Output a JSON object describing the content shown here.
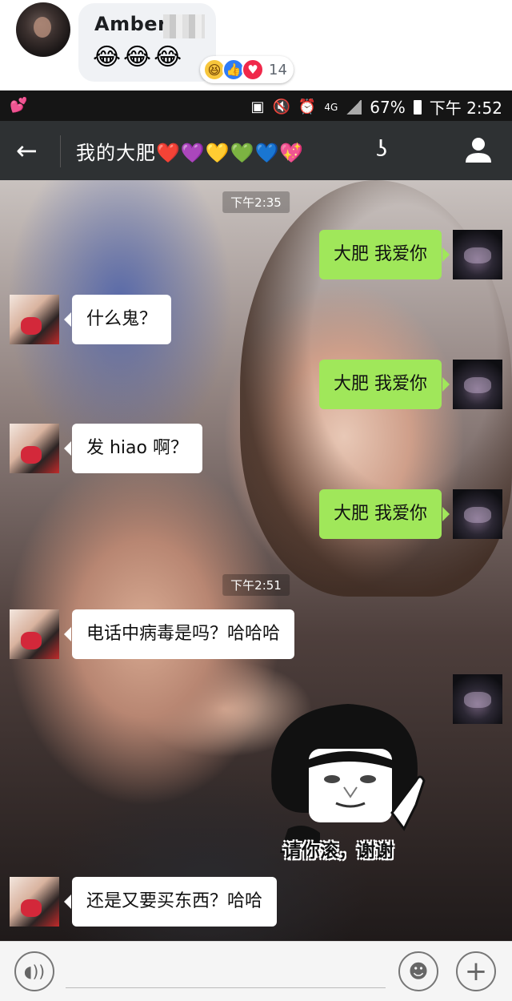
{
  "comment": {
    "author": "Amber",
    "text": "😂😂😂",
    "reaction_count": "14",
    "reactions": [
      "laugh-react-icon",
      "like-react-icon",
      "love-react-icon"
    ]
  },
  "statusbar": {
    "left_icon": "💕",
    "network": "4G",
    "battery": "67%",
    "time": "下午 2:52"
  },
  "header": {
    "title": "我的大肥❤️💜💛💚💙💖",
    "back_icon": "←",
    "ear_icon": "👂"
  },
  "messages": [
    {
      "type": "time",
      "text": "下午2:35"
    },
    {
      "type": "out",
      "text": "大肥 我爱你"
    },
    {
      "type": "in",
      "text": "什么鬼？"
    },
    {
      "type": "out",
      "text": "大肥 我爱你"
    },
    {
      "type": "in",
      "text": "发 hiao 啊？"
    },
    {
      "type": "out",
      "text": "大肥 我爱你"
    },
    {
      "type": "time",
      "text": "下午2:51"
    },
    {
      "type": "in",
      "text": "电话中病毒是吗？哈哈哈"
    },
    {
      "type": "out-sticker",
      "text": "请你滚，谢谢"
    },
    {
      "type": "in",
      "text": "还是又要买东西？哈哈"
    }
  ],
  "colors": {
    "outgoing_bubble": "#a0e75a",
    "incoming_bubble": "#ffffff",
    "header_bg": "#2e3133",
    "statusbar_bg": "#151515"
  }
}
